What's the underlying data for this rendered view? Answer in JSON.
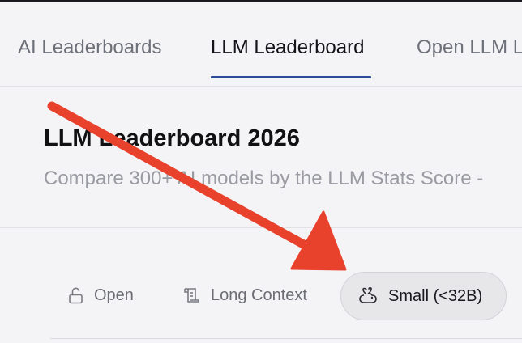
{
  "nav": {
    "tabs": [
      {
        "label": "AI Leaderboards",
        "active": false
      },
      {
        "label": "LLM Leaderboard",
        "active": true
      },
      {
        "label": "Open LLM L",
        "active": false
      }
    ],
    "active_underline_color": "#2d4a9a"
  },
  "hero": {
    "title": "LLM Leaderboard 2026",
    "subtitle": "Compare 300+ AI models by the LLM Stats Score -"
  },
  "filters": [
    {
      "label": "Open",
      "icon": "unlock-icon",
      "selected": false
    },
    {
      "label": "Long Context",
      "icon": "scroll-icon",
      "selected": false
    },
    {
      "label": "Small (<32B)",
      "icon": "rabbit-icon",
      "selected": true
    }
  ],
  "annotation": {
    "type": "arrow",
    "color": "#e8412c",
    "points_to": "Small (<32B)"
  }
}
